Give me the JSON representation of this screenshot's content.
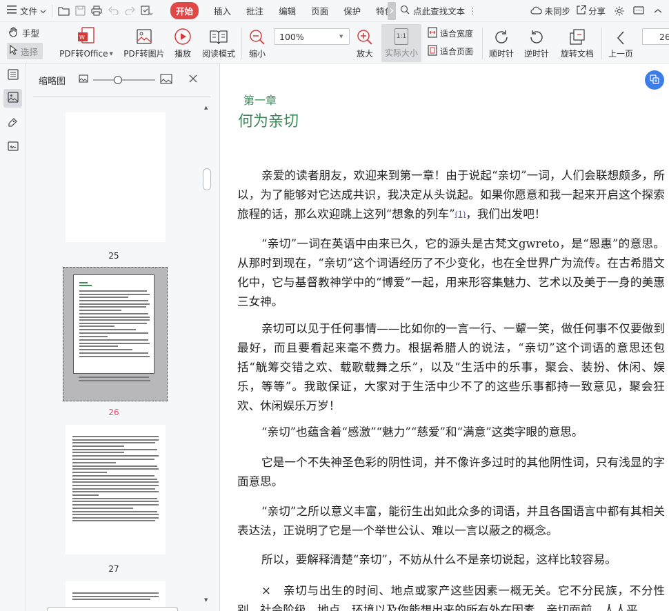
{
  "menubar": {
    "file": "文件",
    "tabs": [
      {
        "label": "开始",
        "active": true
      },
      {
        "label": "插入"
      },
      {
        "label": "批注"
      },
      {
        "label": "编辑"
      },
      {
        "label": "页面"
      },
      {
        "label": "保护"
      },
      {
        "label": "特色"
      }
    ],
    "search_placeholder": "点此查找文本",
    "sync_label": "未同步",
    "share_label": "分享"
  },
  "toolbar": {
    "hand_label": "手型",
    "select_label": "选择",
    "pdf_to_office": "PDF转Office",
    "pdf_to_image": "PDF转图片",
    "play": "播放",
    "read_mode": "阅读模式",
    "zoom_out": "缩小",
    "zoom_value": "100%",
    "zoom_in": "放大",
    "actual_size": "实际大小",
    "actual_size_icon": "1:1",
    "fit_width": "适合宽度",
    "fit_page": "适合页面",
    "rotate_cw": "顺时针",
    "rotate_ccw": "逆时针",
    "rotate_doc": "旋转文档",
    "prev_page": "上一页",
    "page_number": "26"
  },
  "panel": {
    "title": "缩略图",
    "zoom_level": 0.4,
    "thumbnails": [
      {
        "page": "25",
        "selected": false
      },
      {
        "page": "26",
        "selected": true
      },
      {
        "page": "27",
        "selected": false
      }
    ]
  },
  "document": {
    "chapter": "第一章",
    "title": "何为亲切",
    "paragraphs": [
      {
        "pre": "亲爱的读者朋友，欢迎来到第一章！由于说起“亲切”一词，人们会联想颇多，所以，为了能够对它达成共识，我决定从头说起。如果你愿意和我一起来开启这个探索旅程的话，那么欢迎跳上这列“想象的列车”",
        "note": "(1)",
        "post": "，我们出发吧！"
      },
      {
        "text": "“亲切”一词在英语中由来已久，它的源头是古梵文gwreto，是“恩惠”的意思。从那时到现在，“亲切”这个词语经历了不少变化，也在全世界广为流传。在古希腊文化中，它与基督教神学中的“博爱”一起，用来形容集魅力、艺术以及美于一身的美惠三女神。"
      },
      {
        "text": "亲切可以见于任何事情——比如你的一言一行、一颦一笑，做任何事不仅要做到最好，而且要看起来毫不费力。根据希腊人的说法，“亲切”这个词语的意思还包括“觥筹交错之欢、载歌载舞之乐”，以及“生活中的乐事，聚会、装扮、休闲、娱乐，等等”。我敢保证，大家对于生活中少不了的这些乐事都持一致意见，聚会狂欢、休闲娱乐万岁！"
      },
      {
        "text": "“亲切”也蕴含着“感激”“魅力”“慈爱”和“满意”这类字眼的意思。"
      },
      {
        "text": "它是一个不失神圣色彩的阴性词，并不像许多过时的其他阴性词，只有浅显的字面意思。"
      },
      {
        "text": "“亲切”之所以意义丰富，能衍生出如此众多的词语，并且各国语言中都有其相关表达法，正说明了它是一个举世公认、难以一言以蔽之的概念。"
      },
      {
        "text": "所以，要解释清楚“亲切”，不妨从什么不是亲切说起，这样比较容易。"
      },
      {
        "text": "×　亲切与出生的时间、地点或家产这些因素一概无关。它不分民族，不分性别、社会阶级、地点、环境以及你能想出来的所有外在因素。亲切面前，人人平"
      }
    ]
  },
  "colors": {
    "accent_red": "#e04848",
    "chapter_green": "#3d8a5a",
    "link_blue": "#2a4fd6"
  }
}
